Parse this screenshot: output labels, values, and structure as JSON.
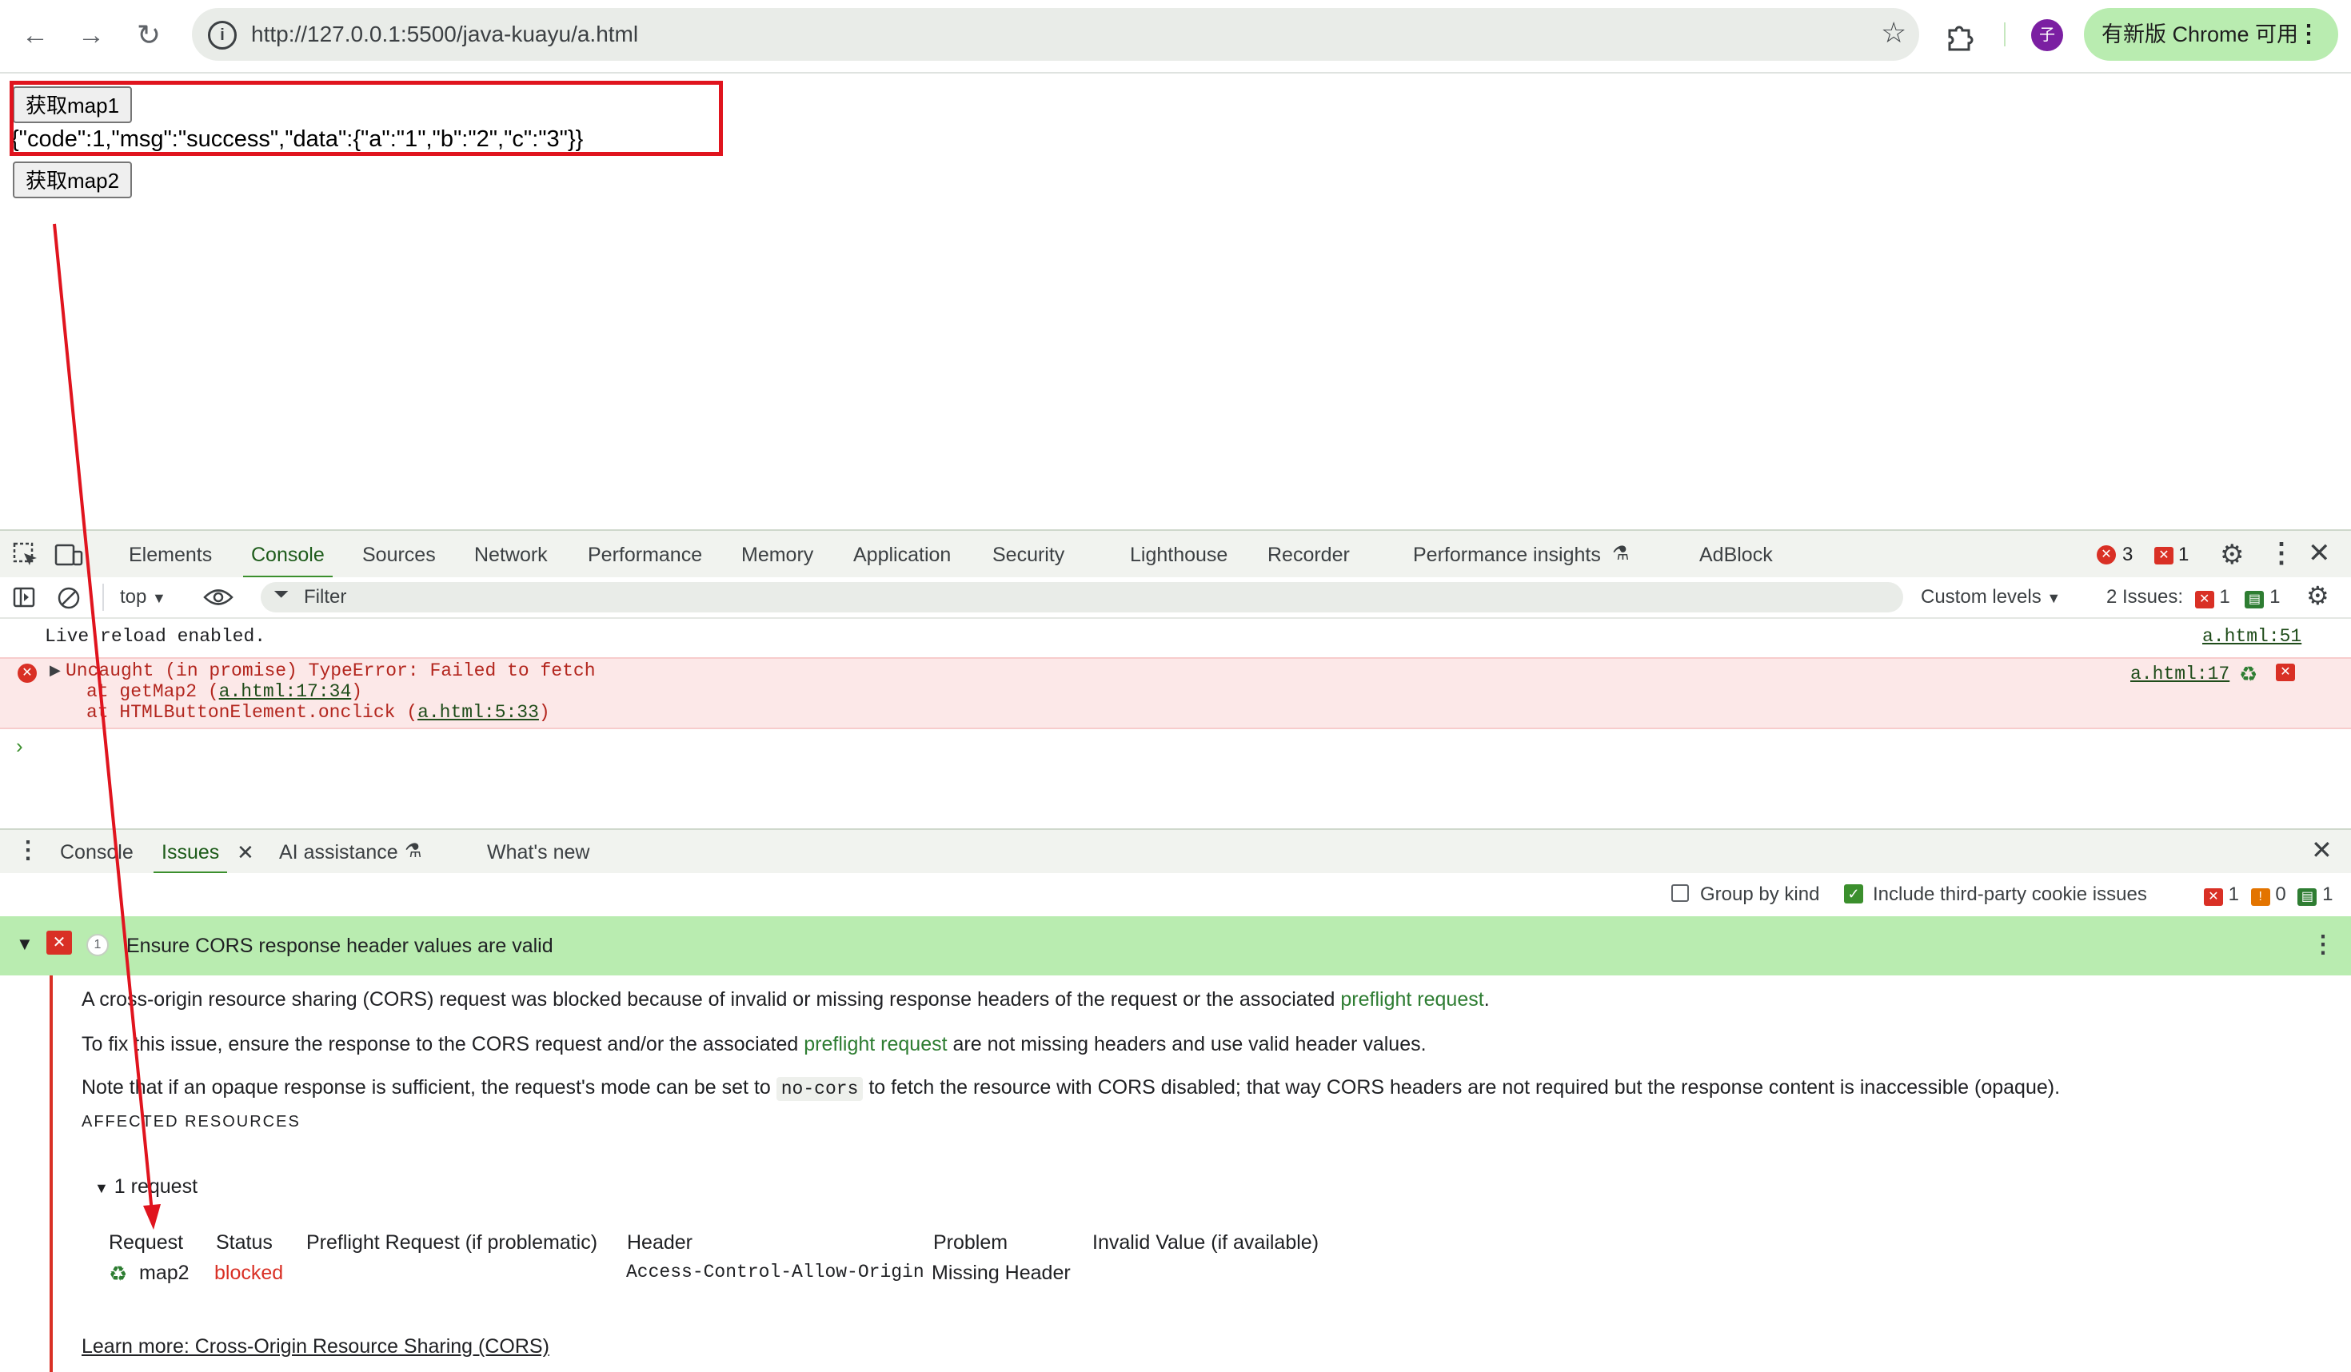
{
  "browser": {
    "url": "http://127.0.0.1:5500/java-kuayu/a.html",
    "update_label": "有新版 Chrome 可用",
    "avatar_letter": "子"
  },
  "page": {
    "button1_label": "获取map1",
    "response_text": "{\"code\":1,\"msg\":\"success\",\"data\":{\"a\":\"1\",\"b\":\"2\",\"c\":\"3\"}}",
    "button2_label": "获取map2"
  },
  "devtools": {
    "tabs": [
      "Elements",
      "Console",
      "Sources",
      "Network",
      "Performance",
      "Memory",
      "Application",
      "Security",
      "Lighthouse",
      "Recorder",
      "Performance insights",
      "AdBlock"
    ],
    "active_tab": "Console",
    "error_count": "3",
    "issue_count": "1",
    "toolbar": {
      "context": "top",
      "filter_placeholder": "Filter",
      "levels": "Custom levels",
      "issues_label": "2 Issues:",
      "issues_error": "1",
      "issues_info": "1"
    },
    "console": {
      "line1_text": "Live reload enabled.",
      "line1_source": "a.html:51",
      "error_main": "Uncaught (in promise) TypeError: Failed to fetch",
      "error_at1_prefix": "at getMap2 (",
      "error_at1_link": "a.html:17:34",
      "error_at1_suffix": ")",
      "error_at2_prefix": "at HTMLButtonElement.onclick (",
      "error_at2_link": "a.html:5:33",
      "error_at2_suffix": ")",
      "error_source": "a.html:17"
    },
    "drawer": {
      "tabs": [
        "Console",
        "Issues",
        "AI assistance",
        "What's new"
      ],
      "active_tab": "Issues",
      "group_by_kind": "Group by kind",
      "include_third_party": "Include third-party cookie issues",
      "count_error": "1",
      "count_warning": "0",
      "count_info": "1"
    },
    "issue": {
      "count": "1",
      "title": "Ensure CORS response header values are valid",
      "p1_before": "A cross-origin resource sharing (CORS) request was blocked because of invalid or missing response headers of the request or the associated ",
      "p1_link": "preflight request",
      "p1_after": ".",
      "p2_before": "To fix this issue, ensure the response to the CORS request and/or the associated ",
      "p2_link": "preflight request",
      "p2_after": " are not missing headers and use valid header values.",
      "p3_before": "Note that if an opaque response is sufficient, the request's mode can be set to ",
      "p3_code": "no-cors",
      "p3_after": " to fetch the resource with CORS disabled; that way CORS headers are not required but the response content is inaccessible (opaque).",
      "affected_label": "AFFECTED RESOURCES",
      "requests_toggle": "1 request",
      "columns": [
        "Request",
        "Status",
        "Preflight Request (if problematic)",
        "Header",
        "Problem",
        "Invalid Value (if available)"
      ],
      "row": {
        "request": "map2",
        "status": "blocked",
        "header": "Access-Control-Allow-Origin",
        "problem": "Missing Header"
      },
      "learn_more": "Learn more: Cross-Origin Resource Sharing (CORS)"
    }
  },
  "colors": {
    "accent_green": "#3b8f2d",
    "error_red": "#d93025",
    "issue_header_bg": "#b9ecb0"
  }
}
